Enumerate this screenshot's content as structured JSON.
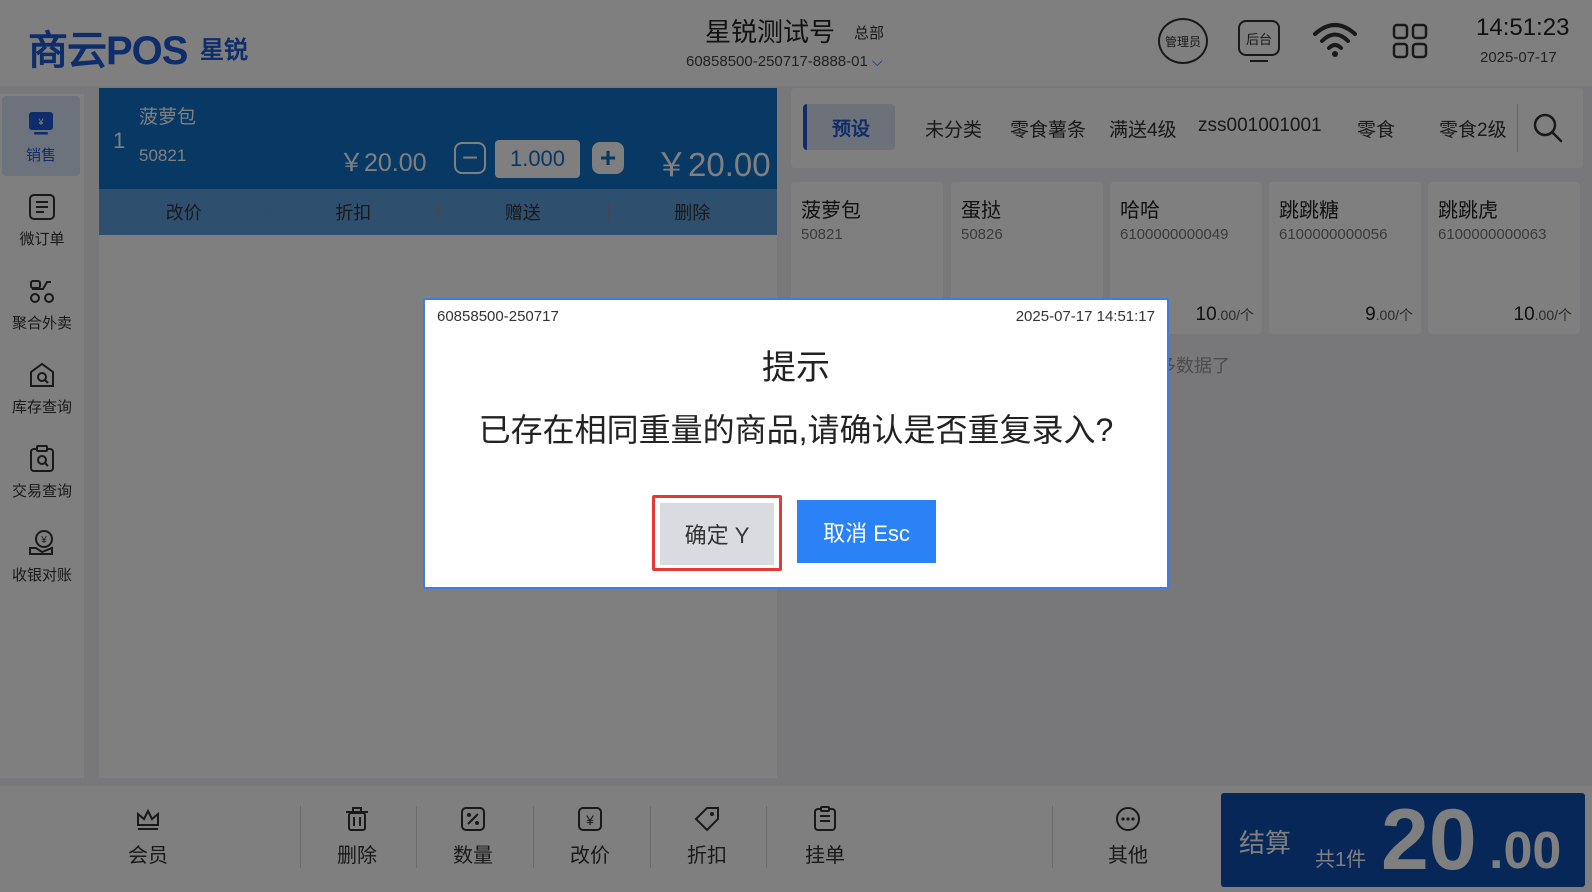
{
  "header": {
    "logo": "商云POS",
    "logo_sub": "星锐",
    "store_name": "星锐测试号",
    "store_tag": "总部",
    "device_id": "60858500-250717-8888-01",
    "admin_label": "管理员",
    "backend_label": "后台",
    "time": "14:51:23",
    "date": "2025-07-17"
  },
  "sidebar": {
    "items": [
      {
        "label": "销售",
        "icon": "sales-icon"
      },
      {
        "label": "微订单",
        "icon": "order-list-icon"
      },
      {
        "label": "聚合外卖",
        "icon": "delivery-icon"
      },
      {
        "label": "库存查询",
        "icon": "inventory-search-icon"
      },
      {
        "label": "交易查询",
        "icon": "transaction-search-icon"
      },
      {
        "label": "收银对账",
        "icon": "reconcile-icon"
      }
    ]
  },
  "order": {
    "index": "1",
    "name": "菠萝包",
    "code": "50821",
    "price": "￥20.00",
    "quantity": "1.000",
    "total": "￥20.00",
    "actions": [
      "改价",
      "折扣",
      "赠送",
      "删除"
    ]
  },
  "categories": {
    "active": "预设",
    "tabs": [
      "未分类",
      "零食薯条",
      "满送4级",
      "zss001001001",
      "零食",
      "零食2级"
    ]
  },
  "products": [
    {
      "name": "菠萝包",
      "code": "50821",
      "price": "",
      "unit": ""
    },
    {
      "name": "蛋挞",
      "code": "50826",
      "price": "",
      "unit": ""
    },
    {
      "name": "哈哈",
      "code": "6100000000049",
      "price": "10",
      "unit": ".00/个"
    },
    {
      "name": "跳跳糖",
      "code": "6100000000056",
      "price": "9",
      "unit": ".00/个"
    },
    {
      "name": "跳跳虎",
      "code": "6100000000063",
      "price": "10",
      "unit": ".00/个"
    }
  ],
  "no_more_text": "更多数据了",
  "toolbar": {
    "items": [
      "会员",
      "删除",
      "数量",
      "改价",
      "折扣",
      "挂单",
      "其他"
    ]
  },
  "checkout": {
    "label": "结算",
    "count": "共1件",
    "amount_int": "20",
    "amount_dec": ".00"
  },
  "dialog": {
    "id": "60858500-250717",
    "timestamp": "2025-07-17 14:51:17",
    "title": "提示",
    "message": "已存在相同重量的商品,请确认是否重复录入?",
    "confirm_label": "确定 Y",
    "cancel_label": "取消 Esc"
  },
  "colors": {
    "brand": "#1e5bd6",
    "order_row": "#0f73c8",
    "checkout": "#0f4fb1",
    "cancel_button": "#2b82f6",
    "highlight": "#e53935"
  }
}
